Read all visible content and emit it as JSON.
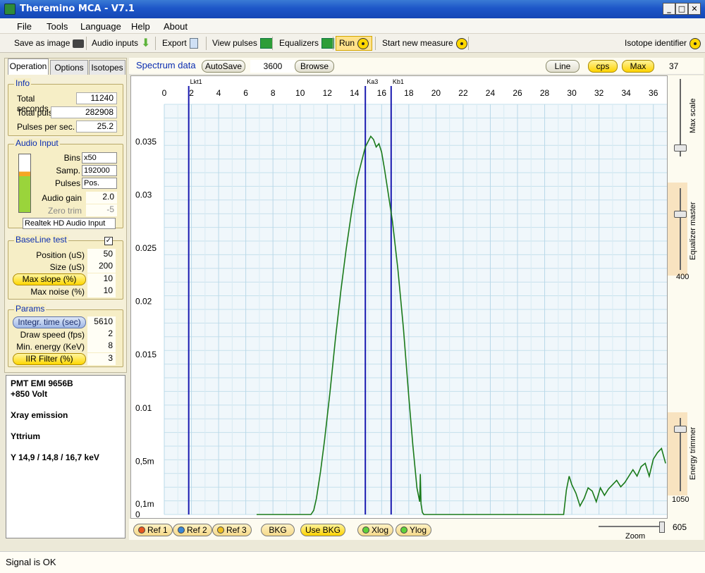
{
  "window": {
    "title": "Theremino MCA - V7.1"
  },
  "menu": [
    "File",
    "Tools",
    "Language",
    "Help",
    "About"
  ],
  "toolbar": {
    "save_image": "Save as image",
    "audio_inputs": "Audio inputs",
    "export": "Export",
    "view_pulses": "View pulses",
    "equalizers": "Equalizers",
    "run": "Run",
    "start_new": "Start new measure",
    "isotope_id": "Isotope identifier"
  },
  "tabs": [
    "Operation",
    "Options",
    "Isotopes"
  ],
  "info": {
    "title": "Info",
    "total_seconds_label": "Total seconds",
    "total_seconds": "11240",
    "total_pulses_label": "Total pulses",
    "total_pulses": "282908",
    "pps_label": "Pulses per sec.",
    "pps": "25.2"
  },
  "audio": {
    "title": "Audio Input",
    "bins_label": "Bins",
    "bins": "x50",
    "samp_label": "Samp.",
    "samp": "192000",
    "pulses_label": "Pulses",
    "pulses": "Pos.",
    "gain_label": "Audio gain",
    "gain": "2.0",
    "zero_label": "Zero trim",
    "zero": "-5",
    "device": "Realtek HD Audio Input",
    "level": 0.3
  },
  "baseline": {
    "title": "BaseLine test",
    "checked": true,
    "position_label": "Position (uS)",
    "position": "50",
    "size_label": "Size (uS)",
    "size": "200",
    "maxslope_label": "Max slope (%)",
    "maxslope": "10",
    "maxnoise_label": "Max noise (%)",
    "maxnoise": "10"
  },
  "params": {
    "title": "Params",
    "integr_label": "Integr. time (sec)",
    "integr": "5610",
    "draw_label": "Draw speed (fps)",
    "draw": "2",
    "minen_label": "Min. energy (KeV)",
    "minen": "8",
    "iir_label": "IIR Filter (%)",
    "iir": "3"
  },
  "notes": [
    "PMT  EMI 9656B",
    "+850 Volt",
    "",
    "Xray emission",
    "",
    "Yttrium",
    "",
    "Y  14,9 / 14,8 / 16,7 keV"
  ],
  "spectrum": {
    "title": "Spectrum data",
    "autosave": "AutoSave",
    "autosave_value": "3600",
    "browse": "Browse",
    "line": "Line",
    "cps": "cps",
    "max": "Max",
    "max_value": "37"
  },
  "right": {
    "max_scale": "Max scale",
    "equalizer_master": "Equalizer master",
    "energy_trimmer": "Energy trimmer",
    "eq_value": "400",
    "trim_value": "1050"
  },
  "bottom": {
    "ref1": "Ref 1",
    "ref2": "Ref 2",
    "ref3": "Ref 3",
    "bkg": "BKG",
    "use_bkg": "Use BKG",
    "xlog": "Xlog",
    "ylog": "Ylog",
    "zoom": "Zoom",
    "zoom_value": "605"
  },
  "status": "Signal is OK",
  "chart_data": {
    "type": "line",
    "xticks": [
      "0",
      "2",
      "4",
      "6",
      "8",
      "10",
      "12",
      "14",
      "16",
      "18",
      "20",
      "22",
      "24",
      "26",
      "28",
      "30",
      "32",
      "34",
      "36"
    ],
    "yticks": [
      {
        "v": 0.035,
        "t": "0.035"
      },
      {
        "v": 0.03,
        "t": "0.03"
      },
      {
        "v": 0.025,
        "t": "0.025"
      },
      {
        "v": 0.02,
        "t": "0.02"
      },
      {
        "v": 0.015,
        "t": "0.015"
      },
      {
        "v": 0.01,
        "t": "0.01"
      },
      {
        "v": 0.005,
        "t": "0,5m"
      },
      {
        "v": 0.001,
        "t": "0,1m"
      },
      {
        "v": 0,
        "t": "0"
      }
    ],
    "xlim": [
      0,
      37
    ],
    "ylim": [
      0,
      0.0385
    ],
    "markers": [
      {
        "x": 1.8,
        "label": "Lkt1"
      },
      {
        "x": 14.8,
        "label": "Ka3"
      },
      {
        "x": 16.7,
        "label": "Kb1"
      }
    ],
    "series": [
      {
        "color": "#1a7a1a",
        "x": [
          6.8,
          10.8,
          11.0,
          11.2,
          11.5,
          11.8,
          12.2,
          12.6,
          13.0,
          13.4,
          13.8,
          14.2,
          14.5,
          14.8,
          15.0,
          15.2,
          15.4,
          15.6,
          15.8,
          16.0,
          16.2,
          16.5,
          16.8,
          17.2,
          17.6,
          18.0,
          18.3,
          18.6,
          18.8,
          18.85,
          18.9,
          19.0,
          19.1,
          29.4,
          29.6,
          29.8,
          30.0,
          30.3,
          30.6,
          30.9,
          31.2,
          31.5,
          31.8,
          32.1,
          32.4,
          32.7,
          33.0,
          33.3,
          33.6,
          33.9,
          34.2,
          34.5,
          34.8,
          35.1,
          35.4,
          35.7,
          36.0,
          36.3,
          36.6,
          36.9
        ],
        "y": [
          0,
          0,
          0.0004,
          0.0015,
          0.004,
          0.007,
          0.0115,
          0.0165,
          0.021,
          0.025,
          0.0285,
          0.0315,
          0.033,
          0.0345,
          0.035,
          0.0355,
          0.0352,
          0.0345,
          0.0348,
          0.034,
          0.0325,
          0.03,
          0.0275,
          0.023,
          0.0175,
          0.011,
          0.0065,
          0.0025,
          0.0012,
          0.0038,
          0.001,
          0.0002,
          0,
          0,
          0.0023,
          0.0036,
          0.0028,
          0.002,
          0.0008,
          0.0015,
          0.0025,
          0.0022,
          0.0012,
          0.0025,
          0.0018,
          0.0024,
          0.0028,
          0.0032,
          0.0026,
          0.003,
          0.0036,
          0.0042,
          0.0036,
          0.0045,
          0.0048,
          0.0036,
          0.0052,
          0.0058,
          0.0062,
          0.0048
        ]
      }
    ]
  }
}
